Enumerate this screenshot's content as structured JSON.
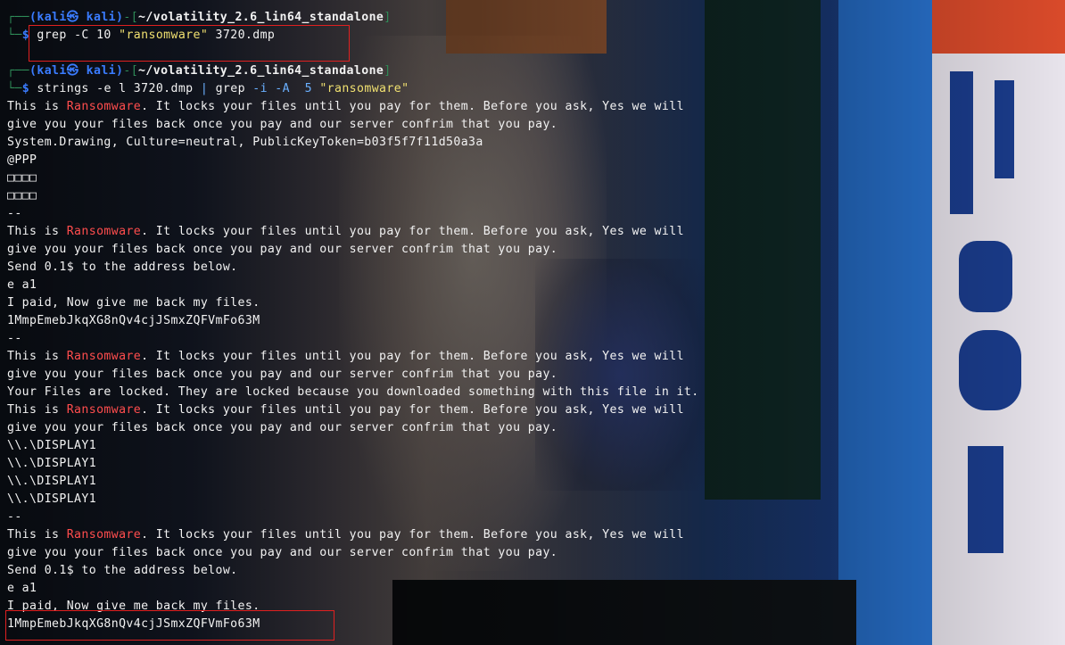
{
  "terminal": {
    "prompts": [
      {
        "user_host": "(kali㉿ kali)",
        "cwd": "~/volatility_2.6_lin64_standalone",
        "command": "grep",
        "args_pre": "-C 10",
        "string_arg": "\"ransomware\"",
        "args_post": "3720.dmp"
      },
      {
        "user_host": "(kali㉿ kali)",
        "cwd": "~/volatility_2.6_lin64_standalone",
        "command": "strings",
        "args_pre": "-e l 3720.dmp",
        "pipe": "|",
        "command2": "grep",
        "args_mid": "-i -A  5",
        "string_arg": "\"ransomware\""
      }
    ],
    "keyword": "Ransomware",
    "output": [
      {
        "type": "hit",
        "before": "This is ",
        "after": ". It locks your files until you pay for them. Before you ask, Yes we will"
      },
      {
        "type": "text",
        "text": "give you your files back once you pay and our server confrim that you pay."
      },
      {
        "type": "text",
        "text": "System.Drawing, Culture=neutral, PublicKeyToken=b03f5f7f11d50a3a"
      },
      {
        "type": "text",
        "text": "@PPP"
      },
      {
        "type": "text",
        "text": "□□□□"
      },
      {
        "type": "text",
        "text": "□□□□"
      },
      {
        "type": "text",
        "text": "--"
      },
      {
        "type": "hit",
        "before": "This is ",
        "after": ". It locks your files until you pay for them. Before you ask, Yes we will"
      },
      {
        "type": "text",
        "text": "give you your files back once you pay and our server confrim that you pay."
      },
      {
        "type": "text",
        "text": "Send 0.1$ to the address below."
      },
      {
        "type": "text",
        "text": "e a1"
      },
      {
        "type": "text",
        "text": "I paid, Now give me back my files."
      },
      {
        "type": "text",
        "text": "1MmpEmebJkqXG8nQv4cjJSmxZQFVmFo63M"
      },
      {
        "type": "text",
        "text": "--"
      },
      {
        "type": "hit",
        "before": "This is ",
        "after": ". It locks your files until you pay for them. Before you ask, Yes we will"
      },
      {
        "type": "text",
        "text": "give you your files back once you pay and our server confrim that you pay."
      },
      {
        "type": "text",
        "text": "Your Files are locked. They are locked because you downloaded something with this file in it."
      },
      {
        "type": "hit",
        "before": "This is ",
        "after": ". It locks your files until you pay for them. Before you ask, Yes we will"
      },
      {
        "type": "text",
        "text": "give you your files back once you pay and our server confrim that you pay."
      },
      {
        "type": "text",
        "text": "\\\\.\\DISPLAY1"
      },
      {
        "type": "text",
        "text": "\\\\.\\DISPLAY1"
      },
      {
        "type": "text",
        "text": "\\\\.\\DISPLAY1"
      },
      {
        "type": "text",
        "text": "\\\\.\\DISPLAY1"
      },
      {
        "type": "text",
        "text": "--"
      },
      {
        "type": "hit",
        "before": "This is ",
        "after": ". It locks your files until you pay for them. Before you ask, Yes we will"
      },
      {
        "type": "text",
        "text": "give you your files back once you pay and our server confrim that you pay."
      },
      {
        "type": "text",
        "text": "Send 0.1$ to the address below."
      },
      {
        "type": "text",
        "text": "e a1"
      },
      {
        "type": "text",
        "text": "I paid, Now give me back my files."
      },
      {
        "type": "text",
        "text": "1MmpEmebJkqXG8nQv4cjJSmxZQFVmFo63M"
      }
    ]
  },
  "colors": {
    "prompt_blue": "#3a7cff",
    "prompt_box_green": "#2e8b57",
    "keyword_red": "#ff4d4d",
    "string_yellow": "#f0e070",
    "annotation_red": "#e02020"
  }
}
